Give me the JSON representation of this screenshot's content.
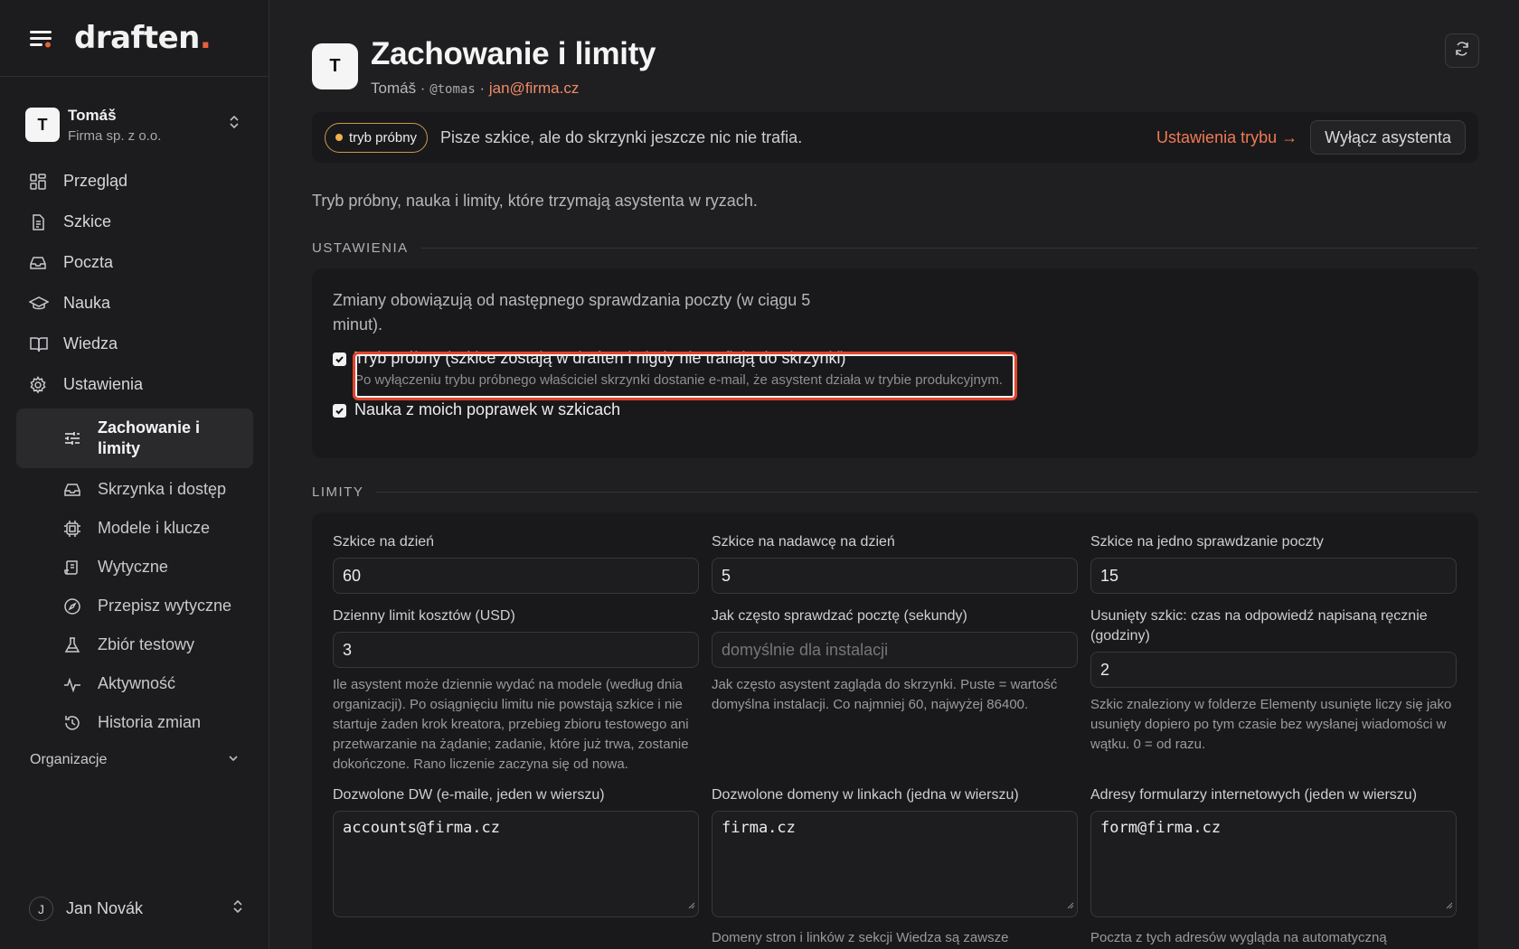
{
  "brand": {
    "name": "draften",
    "dot": "."
  },
  "org": {
    "initial": "T",
    "name": "Tomáš",
    "company": "Firma sp. z o.o."
  },
  "nav": {
    "items": [
      "Przegląd",
      "Szkice",
      "Poczta",
      "Nauka",
      "Wiedza",
      "Ustawienia"
    ],
    "sub": [
      "Zachowanie i limity",
      "Skrzynka i dostęp",
      "Modele i klucze",
      "Wytyczne",
      "Przepisz wytyczne",
      "Zbiór testowy",
      "Aktywność",
      "Historia zmian"
    ]
  },
  "organizations_label": "Organizacje",
  "user": {
    "initial": "J",
    "name": "Jan Novák"
  },
  "header": {
    "initial": "T",
    "title": "Zachowanie i limity",
    "name": "Tomáš",
    "sep": " · ",
    "handle": "@tomas",
    "email": "jan@firma.cz"
  },
  "banner": {
    "badge": "tryb próbny",
    "text": "Pisze szkice, ale do skrzynki jeszcze nic nie trafia.",
    "link": "Ustawienia trybu →",
    "button": "Wyłącz asystenta"
  },
  "intro": "Tryb próbny, nauka i limity, które trzymają asystenta w ryzach.",
  "settings": {
    "heading": "USTAWIENIA",
    "note": "Zmiany obowiązują od następnego sprawdzania poczty (w ciągu 5 minut).",
    "dry_run_label": "Tryb próbny (szkice zostają w draften i nigdy nie trafiają do skrzynki)",
    "dry_run_help": "Po wyłączeniu trybu próbnego właściciel skrzynki dostanie e-mail, że asystent działa w trybie produkcyjnym.",
    "learning_label": "Nauka z moich poprawek w szkicach"
  },
  "limits": {
    "heading": "LIMITY",
    "drafts_per_day": {
      "label": "Szkice na dzień",
      "value": "60"
    },
    "drafts_per_sender": {
      "label": "Szkice na nadawcę na dzień",
      "value": "5"
    },
    "drafts_per_check": {
      "label": "Szkice na jedno sprawdzanie poczty",
      "value": "15"
    },
    "cost_limit": {
      "label": "Dzienny limit kosztów (USD)",
      "value": "3",
      "help": "Ile asystent może dziennie wydać na modele (według dnia organizacji). Po osiągnięciu limitu nie powstają szkice i nie startuje żaden krok kreatora, przebieg zbioru testowego ani przetwarzanie na żądanie; zadanie, które już trwa, zostanie dokończone. Rano liczenie zaczyna się od nowa."
    },
    "poll_interval": {
      "label": "Jak często sprawdzać pocztę (sekundy)",
      "placeholder": "domyślnie dla instalacji",
      "help": "Jak często asystent zagląda do skrzynki. Puste = wartość domyślna instalacji. Co najmniej 60, najwyżej 86400."
    },
    "deleted_grace": {
      "label": "Usunięty szkic: czas na odpowiedź napisaną ręcznie (godziny)",
      "value": "2",
      "help": "Szkic znaleziony w folderze Elementy usunięte liczy się jako usunięty dopiero po tym czasie bez wysłanej wiadomości w wątku. 0 = od razu."
    },
    "allowed_cc": {
      "label": "Dozwolone DW (e-maile, jeden w wierszu)",
      "value": "accounts@firma.cz"
    },
    "allowed_domains": {
      "label": "Dozwolone domeny w linkach (jedna w wierszu)",
      "value": "firma.cz",
      "help": "Domeny stron i linków z sekcji Wiedza są zawsze"
    },
    "form_addresses": {
      "label": "Adresy formularzy internetowych (jeden w wierszu)",
      "value": "form@firma.cz",
      "help": "Poczta z tych adresów wygląda na automatyczną"
    }
  }
}
